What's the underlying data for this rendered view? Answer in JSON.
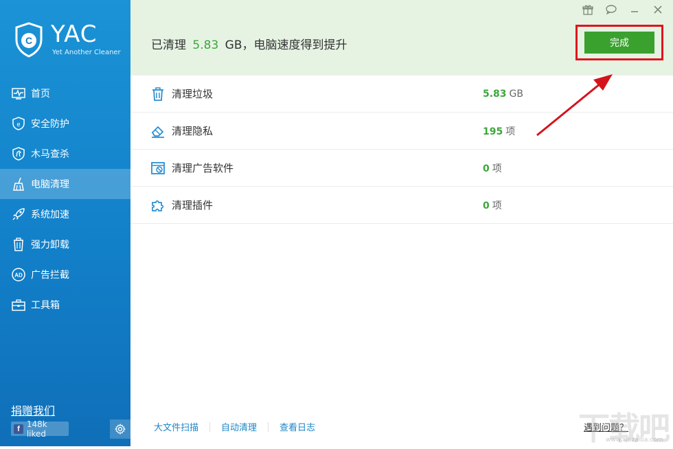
{
  "app": {
    "title": "YAC",
    "subtitle": "Yet Another Cleaner"
  },
  "sidebar": {
    "items": [
      {
        "label": "首页",
        "icon": "monitor-pulse-icon",
        "active": false
      },
      {
        "label": "安全防护",
        "icon": "shield-e-icon",
        "active": false
      },
      {
        "label": "木马查杀",
        "icon": "shield-horse-icon",
        "active": false
      },
      {
        "label": "电脑清理",
        "icon": "broom-icon",
        "active": true
      },
      {
        "label": "系统加速",
        "icon": "rocket-icon",
        "active": false
      },
      {
        "label": "强力卸载",
        "icon": "trash-icon",
        "active": false
      },
      {
        "label": "广告拦截",
        "icon": "ad-block-icon",
        "active": false
      },
      {
        "label": "工具箱",
        "icon": "toolbox-icon",
        "active": false
      }
    ],
    "donate_label": "捐赠我们",
    "liked_label": "148k liked"
  },
  "header": {
    "prefix": "已清理",
    "size": "5.83",
    "unit_suffix": "GB，电脑速度得到提升",
    "done_label": "完成"
  },
  "results": [
    {
      "label": "清理垃圾",
      "value": "5.83",
      "unit": "GB",
      "icon": "trash-icon"
    },
    {
      "label": "清理隐私",
      "value": "195",
      "unit": "项",
      "icon": "eraser-icon"
    },
    {
      "label": "清理广告软件",
      "value": "0",
      "unit": "项",
      "icon": "ad-window-icon"
    },
    {
      "label": "清理插件",
      "value": "0",
      "unit": "项",
      "icon": "puzzle-icon"
    }
  ],
  "footer": {
    "links": [
      "大文件扫描",
      "自动清理",
      "查看日志"
    ],
    "help": "遇到问题？"
  },
  "watermark": {
    "text": "下载吧",
    "url": "www.xiazaiba.com"
  },
  "colors": {
    "sidebar": "#1480c9",
    "header_bg": "#e6f3e3",
    "accent_green": "#3ca63c",
    "done_button": "#3aa12e",
    "highlight_red": "#e0141e",
    "link_blue": "#1a86c8"
  }
}
